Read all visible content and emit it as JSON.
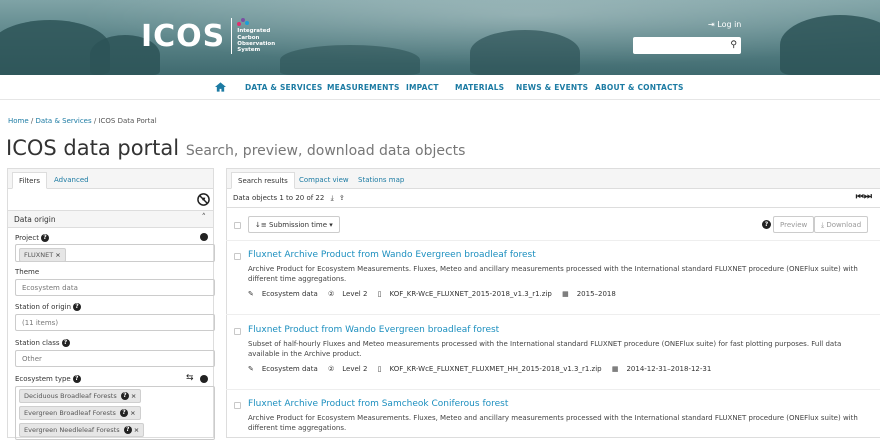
{
  "header": {
    "logo": "ICOS",
    "logo_subtitle": [
      "Integrated",
      "Carbon",
      "Observation",
      "System"
    ],
    "login": "Log in",
    "search_placeholder": ""
  },
  "nav": {
    "items": [
      "DATA & SERVICES",
      "MEASUREMENTS",
      "IMPACT",
      "MATERIALS",
      "NEWS & EVENTS",
      "ABOUT & CONTACTS"
    ]
  },
  "breadcrumb": {
    "home": "Home",
    "sep": "/",
    "data_services": "Data & Services",
    "current": "ICOS Data Portal"
  },
  "page": {
    "title": "ICOS data portal",
    "subtitle": "Search, preview, download data objects"
  },
  "filters": {
    "tabs": [
      "Filters",
      "Advanced"
    ],
    "section": "Data origin",
    "project_label": "Project",
    "project_tag": "FLUXNET",
    "theme_label": "Theme",
    "theme_placeholder": "Ecosystem data",
    "station_label": "Station of origin",
    "station_placeholder": "(11 items)",
    "class_label": "Station class",
    "class_placeholder": "Other",
    "eco_label": "Ecosystem type",
    "eco_tags": [
      "Deciduous Broadleaf Forests",
      "Evergreen Broadleaf Forests",
      "Evergreen Needleleaf Forests"
    ]
  },
  "results": {
    "tabs": [
      "Search results",
      "Compact view",
      "Stations map"
    ],
    "count": "Data objects 1 to 20 of 22",
    "sort": "Submission time",
    "preview": "Preview",
    "download": "Download",
    "items": [
      {
        "title": "Fluxnet Archive Product from Wando Evergreen broadleaf forest",
        "desc": "Archive Product for Ecosystem Measurements. Fluxes, Meteo and ancillary measurements processed with the International standard FLUXNET procedure (ONEFlux suite) with different time aggregations.",
        "theme": "Ecosystem data",
        "level": "Level 2",
        "file": "KOF_KR-WcE_FLUXNET_2015-2018_v1.3_r1.zip",
        "time": "2015–2018"
      },
      {
        "title": "Fluxnet Product from Wando Evergreen broadleaf forest",
        "desc": "Subset of half-hourly Fluxes and Meteo measurements processed with the International standard FLUXNET procedure (ONEFlux suite) for fast plotting purposes. Full data available in the Archive product.",
        "theme": "Ecosystem data",
        "level": "Level 2",
        "file": "KOF_KR-WcE_FLUXNET_FLUXMET_HH_2015-2018_v1.3_r1.zip",
        "time": "2014-12-31–2018-12-31"
      },
      {
        "title": "Fluxnet Archive Product from Samcheok Coniferous forest",
        "desc": "Archive Product for Ecosystem Measurements. Fluxes, Meteo and ancillary measurements processed with the International standard FLUXNET procedure (ONEFlux suite) with different time aggregations."
      }
    ]
  }
}
